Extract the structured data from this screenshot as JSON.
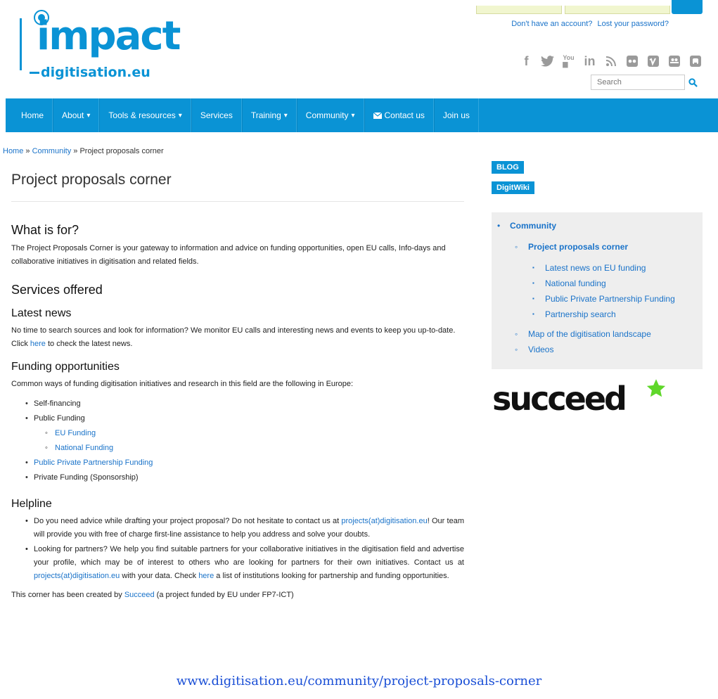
{
  "logo": {
    "word": "impact",
    "sub": "digitisation.eu"
  },
  "account": {
    "no_account": "Don't have an account?",
    "lost_password": "Lost your password?"
  },
  "social_icons": [
    "facebook-icon",
    "twitter-icon",
    "youtube-icon",
    "linkedin-icon",
    "rss-icon",
    "flickr-icon",
    "vimeo-icon",
    "slideshare-icon",
    "github-icon"
  ],
  "search": {
    "placeholder": "Search"
  },
  "nav": [
    {
      "label": "Home",
      "caret": ""
    },
    {
      "label": "About",
      "caret": "▾"
    },
    {
      "label": "Tools & resources",
      "caret": "▾"
    },
    {
      "label": "Services",
      "caret": ""
    },
    {
      "label": "Training",
      "caret": "▾"
    },
    {
      "label": "Community",
      "caret": "▾"
    },
    {
      "label": "Contact us",
      "caret": ""
    },
    {
      "label": "Join us",
      "caret": ""
    }
  ],
  "breadcrumb": {
    "home": "Home",
    "sep1": " » ",
    "community": "Community",
    "sep2": " » ",
    "current": "Project proposals corner"
  },
  "page_title": "Project proposals corner",
  "what_is_for": {
    "heading": "What is for?",
    "text": "The Project Proposals Corner is your gateway to information and advice on funding opportunities, open EU calls, Info-days and collaborative initiatives in digitisation and related fields."
  },
  "services_heading": "Services offered",
  "latest_news": {
    "heading": "Latest news",
    "text_before": "No time to search sources and look for information? We monitor EU calls and interesting news and events to keep you up-to-date. Click ",
    "link": "here",
    "text_after": " to check the latest news."
  },
  "funding": {
    "heading": "Funding opportunities",
    "intro": "Common ways of funding digitisation initiatives and research in this field are the following in Europe:",
    "items": {
      "self": "Self-financing",
      "public": "Public Funding",
      "eu": "EU Funding",
      "national": "National Funding",
      "ppp": "Public Private Partnership Funding",
      "private": "Private Funding (Sponsorship)"
    }
  },
  "helpline": {
    "heading": "Helpline",
    "item1_a": "Do you need advice while drafting your project proposal? Do not hesitate to contact us at ",
    "item1_link": "projects(at)digitisation.eu",
    "item1_b": "! Our team will provide you with free of charge first-line assistance to help you address and solve your doubts.",
    "item2_a": "Looking for partners? We help you find suitable partners for your collaborative initiatives in the digitisation field and advertise your profile, which may be of interest to others who are looking for partners for their own initiatives. Contact us at ",
    "item2_link": "projects(at)digitisation.eu",
    "item2_b": " with your data. Check ",
    "item2_link2": "here",
    "item2_c": " a list of institutions looking for partnership and funding opportunities."
  },
  "footer_note": {
    "before": "This corner has been created by ",
    "link": "Succeed",
    "after": " (a project funded by EU under FP7-ICT)"
  },
  "sidebar": {
    "blog": "BLOG",
    "wiki": "DigitWiki",
    "menu": {
      "community": "Community",
      "ppc": "Project proposals corner",
      "latest": "Latest news on EU funding",
      "national": "National funding",
      "ppp": "Public Private Partnership Funding",
      "partnership": "Partnership search",
      "map": "Map of the digitisation landscape",
      "videos": "Videos"
    },
    "succeed_word": "succeed"
  },
  "url_caption": "www.digitisation.eu/community/project-proposals-corner",
  "colors": {
    "brand": "#0a93d5",
    "link": "#1a73c9",
    "caption": "#1a4fd6"
  }
}
